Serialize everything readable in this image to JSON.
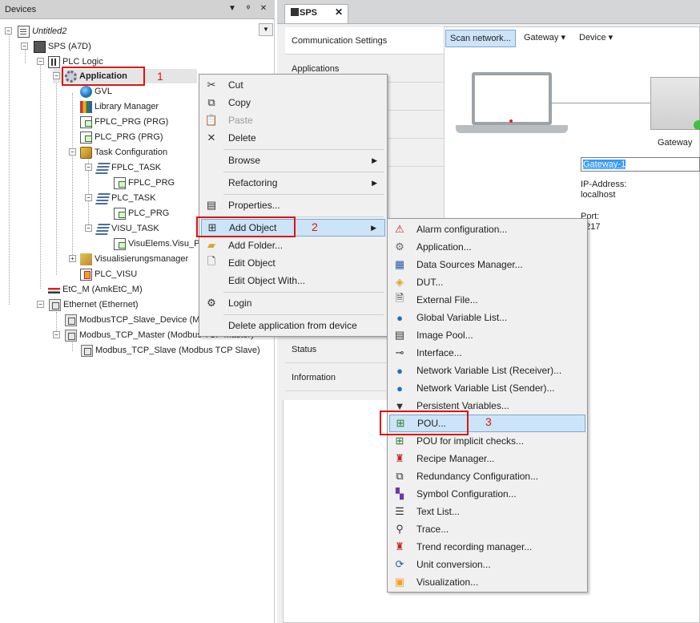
{
  "devices_panel": {
    "title": "Devices",
    "header_buttons": [
      "▼",
      "ᵠ",
      "✕"
    ],
    "tree": [
      {
        "label": "Untitled2",
        "italic": true
      },
      {
        "label": "SPS (A7D)"
      },
      {
        "label": "PLC Logic"
      },
      {
        "label": "Application",
        "bold": true
      },
      {
        "label": "GVL"
      },
      {
        "label": "Library Manager"
      },
      {
        "label": "FPLC_PRG (PRG)"
      },
      {
        "label": "PLC_PRG (PRG)"
      },
      {
        "label": "Task Configuration"
      },
      {
        "label": "FPLC_TASK"
      },
      {
        "label": "FPLC_PRG"
      },
      {
        "label": "PLC_TASK"
      },
      {
        "label": "PLC_PRG"
      },
      {
        "label": "VISU_TASK"
      },
      {
        "label": "VisuElems.Visu_Pr"
      },
      {
        "label": "Visualisierungsmanager"
      },
      {
        "label": "PLC_VISU"
      },
      {
        "label": "EtC_M (AmkEtC_M)"
      },
      {
        "label": "Ethernet (Ethernet)"
      },
      {
        "label": "ModbusTCP_Slave_Device (Mo"
      },
      {
        "label": "Modbus_TCP_Master (Modbus TCP Master)"
      },
      {
        "label": "Modbus_TCP_Slave (Modbus TCP Slave)"
      }
    ]
  },
  "annotations": {
    "step1": "1",
    "step2": "2",
    "step3": "3",
    "color": "#e01010"
  },
  "sps_editor": {
    "tab_label": "SPS",
    "tab_close": "✕",
    "nav": [
      {
        "label": "Communication Settings"
      },
      {
        "label": "Applications"
      },
      {
        "label": "Status"
      },
      {
        "label": "Information"
      }
    ],
    "toolbar": {
      "scan_network": "Scan network...",
      "gateway": "Gateway ▾",
      "device": "Device ▾"
    },
    "gateway": {
      "label": "Gateway",
      "name_value": "Gateway-1",
      "ip_label": "IP-Address:",
      "ip_value": "localhost",
      "port_label": "Port:",
      "port_value": "1217"
    }
  },
  "context_menu": {
    "items": [
      {
        "label": "Cut",
        "icon": "scissors-icon"
      },
      {
        "label": "Copy",
        "icon": "copy-icon"
      },
      {
        "label": "Paste",
        "icon": "paste-icon",
        "disabled": true
      },
      {
        "label": "Delete",
        "icon": "delete-icon"
      },
      {
        "label": "Browse",
        "submenu": true
      },
      {
        "label": "Refactoring",
        "submenu": true
      },
      {
        "label": "Properties...",
        "icon": "properties-icon"
      },
      {
        "label": "Add Object",
        "icon": "add-object-icon",
        "submenu": true,
        "highlighted": true
      },
      {
        "label": "Add Folder...",
        "icon": "folder-icon"
      },
      {
        "label": "Edit Object",
        "icon": "edit-object-icon"
      },
      {
        "label": "Edit Object With..."
      },
      {
        "label": "Login",
        "icon": "login-icon"
      },
      {
        "label": "Delete application from device"
      }
    ]
  },
  "submenu": {
    "items": [
      {
        "label": "Alarm configuration...",
        "icon": "alarm-icon"
      },
      {
        "label": "Application...",
        "icon": "gear-icon"
      },
      {
        "label": "Data Sources Manager...",
        "icon": "data-sources-icon"
      },
      {
        "label": "DUT...",
        "icon": "dut-icon"
      },
      {
        "label": "External File...",
        "icon": "external-file-icon"
      },
      {
        "label": "Global Variable List...",
        "icon": "globe-icon"
      },
      {
        "label": "Image Pool...",
        "icon": "image-pool-icon"
      },
      {
        "label": "Interface...",
        "icon": "interface-icon"
      },
      {
        "label": "Network Variable List (Receiver)...",
        "icon": "network-receiver-icon"
      },
      {
        "label": "Network Variable List (Sender)...",
        "icon": "network-sender-icon"
      },
      {
        "label": "Persistent Variables...",
        "icon": "persistent-icon"
      },
      {
        "label": "POU...",
        "icon": "pou-icon",
        "highlighted": true
      },
      {
        "label": "POU for implicit checks...",
        "icon": "pou-checks-icon"
      },
      {
        "label": "Recipe Manager...",
        "icon": "recipe-icon"
      },
      {
        "label": "Redundancy Configuration...",
        "icon": "redundancy-icon"
      },
      {
        "label": "Symbol Configuration...",
        "icon": "symbol-icon"
      },
      {
        "label": "Text List...",
        "icon": "text-list-icon"
      },
      {
        "label": "Trace...",
        "icon": "trace-icon"
      },
      {
        "label": "Trend recording manager...",
        "icon": "trend-icon"
      },
      {
        "label": "Unit conversion...",
        "icon": "unit-conversion-icon"
      },
      {
        "label": "Visualization...",
        "icon": "visualization-icon"
      }
    ]
  }
}
